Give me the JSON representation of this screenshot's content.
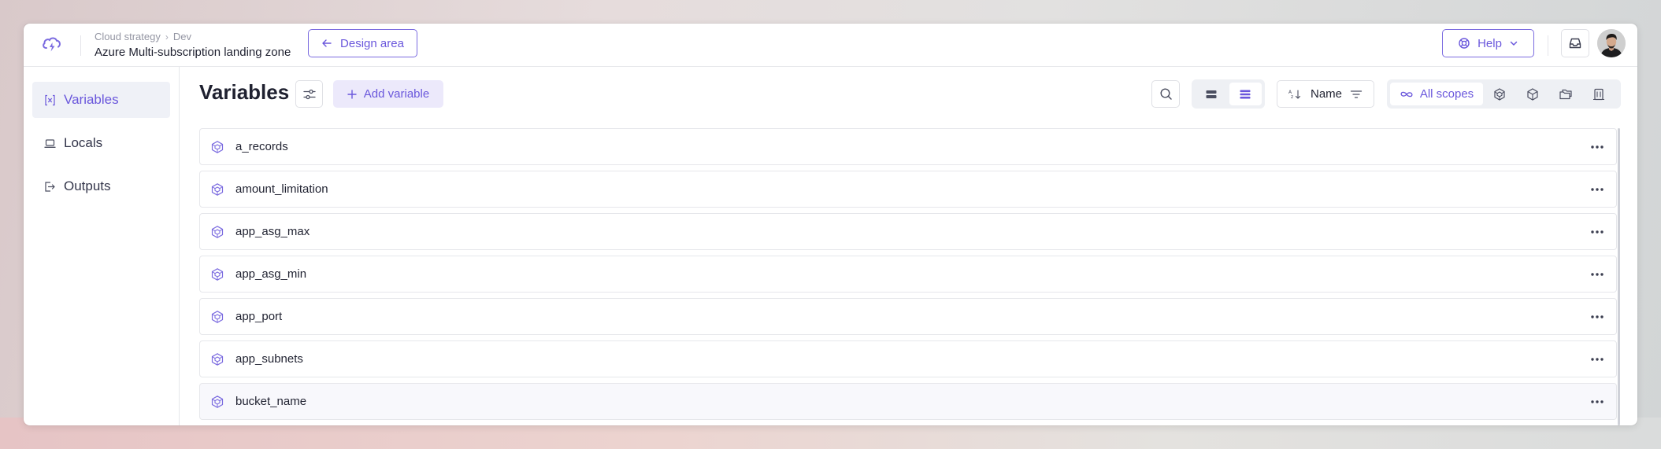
{
  "header": {
    "breadcrumb": [
      "Cloud strategy",
      "Dev"
    ],
    "breadcrumb_sep": "›",
    "project_title": "Azure Multi-subscription landing zone",
    "design_area_label": "Design area",
    "help_label": "Help"
  },
  "sidebar": {
    "items": [
      {
        "label": "Variables",
        "icon": "variable-icon",
        "active": true
      },
      {
        "label": "Locals",
        "icon": "laptop-icon",
        "active": false
      },
      {
        "label": "Outputs",
        "icon": "output-icon",
        "active": false
      }
    ]
  },
  "main": {
    "title": "Variables",
    "add_variable_label": "Add variable",
    "sort_label": "Name",
    "scope_all_label": "All scopes"
  },
  "variables": [
    "a_records",
    "amount_limitation",
    "app_asg_max",
    "app_asg_min",
    "app_port",
    "app_subnets",
    "bucket_name"
  ],
  "colors": {
    "accent": "#6a57dc",
    "icon_gray": "#6b6e7c"
  }
}
